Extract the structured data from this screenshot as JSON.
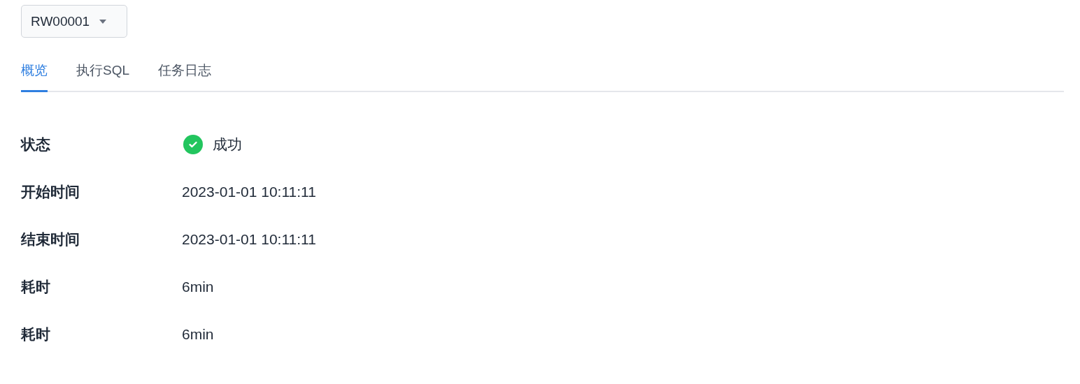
{
  "task_select": {
    "value": "RW00001"
  },
  "tabs": [
    {
      "label": "概览",
      "selected": true
    },
    {
      "label": "执行SQL",
      "selected": false
    },
    {
      "label": "任务日志",
      "selected": false
    }
  ],
  "details": [
    {
      "kind": "status",
      "label": "状态",
      "value": "成功",
      "color": "#22c55e"
    },
    {
      "kind": "text",
      "label": "开始时间",
      "value": "2023-01-01 10:11:11"
    },
    {
      "kind": "text",
      "label": "结束时间",
      "value": "2023-01-01 10:11:11"
    },
    {
      "kind": "text",
      "label": "耗时",
      "value": "6min"
    },
    {
      "kind": "text",
      "label": "耗时",
      "value": "6min"
    }
  ]
}
